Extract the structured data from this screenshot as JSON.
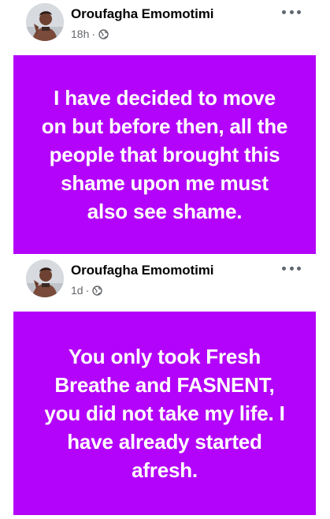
{
  "posts": [
    {
      "author": "Oroufagha Emomotimi",
      "time": "18h",
      "separator": "·",
      "privacy_icon": "globe-icon",
      "more_icon": "more-horizontal-icon",
      "text": "I have decided to move on but before then, all the people that brought this shame upon me must also see shame.",
      "background_color": "#b403fa",
      "text_color": "#ffffff"
    },
    {
      "author": "Oroufagha Emomotimi",
      "time": "1d",
      "separator": "·",
      "privacy_icon": "globe-icon",
      "more_icon": "more-horizontal-icon",
      "text": "You only took Fresh Breathe and FASNENT, you did not take my life. I have already started afresh.",
      "background_color": "#b403fa",
      "text_color": "#ffffff"
    }
  ],
  "colors": {
    "name_text": "#050505",
    "meta_text": "#65676b",
    "page_background": "#ffffff"
  }
}
